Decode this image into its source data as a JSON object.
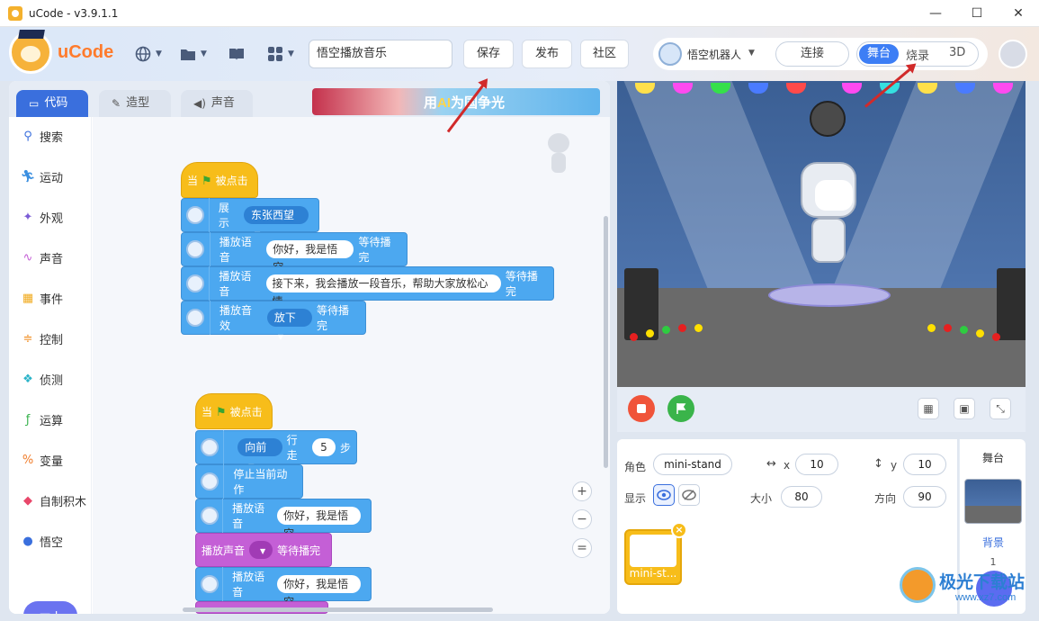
{
  "window": {
    "title": "uCode - v3.9.1.1",
    "controls": [
      "—",
      "☐",
      "✕"
    ]
  },
  "toolbar": {
    "logo": "uCode",
    "project_name": "悟空播放音乐",
    "save_label": "保存",
    "publish_label": "发布",
    "community_label": "社区",
    "robot_name": "悟空机器人",
    "connect_label": "连接",
    "mode_stage_label": "舞台",
    "mode_burn_label": "烧录",
    "mode_3d_label": "3D"
  },
  "editor": {
    "tabs": [
      {
        "label": "代码",
        "icon": "code-icon"
      },
      {
        "label": "造型",
        "icon": "brush-icon"
      },
      {
        "label": "声音",
        "icon": "speaker-icon"
      }
    ],
    "banner_text_pre": "用",
    "banner_text_ai": "AI",
    "banner_text_post": "为国争光",
    "categories": [
      {
        "label": "搜索",
        "icon": "search-icon",
        "color": "#3a6fdd"
      },
      {
        "label": "运动",
        "icon": "run-icon",
        "color": "#3a8fe0"
      },
      {
        "label": "外观",
        "icon": "sparkle-icon",
        "color": "#7b5cd6"
      },
      {
        "label": "声音",
        "icon": "sound-wave-icon",
        "color": "#c45fd6"
      },
      {
        "label": "事件",
        "icon": "calendar-icon",
        "color": "#f0a91b"
      },
      {
        "label": "控制",
        "icon": "sliders-icon",
        "color": "#f08a1b"
      },
      {
        "label": "侦测",
        "icon": "sensor-icon",
        "color": "#2ab3c8"
      },
      {
        "label": "运算",
        "icon": "fx-icon",
        "color": "#37b24d"
      },
      {
        "label": "变量",
        "icon": "variable-icon",
        "color": "#f07c2a"
      },
      {
        "label": "自制积木",
        "icon": "custom-block-icon",
        "color": "#e8476a"
      },
      {
        "label": "悟空",
        "icon": "wukong-icon",
        "color": "#3a6fdd"
      }
    ],
    "script1": {
      "hat_pre": "当",
      "hat_post": "被点击",
      "blocks": [
        {
          "label": "展示",
          "dropdown": "东张西望"
        },
        {
          "label": "播放语音",
          "input": "你好，我是悟空",
          "suffix": "等待播完"
        },
        {
          "label": "播放语音",
          "input": "接下来，我会播放一段音乐，帮助大家放松心情",
          "suffix": "等待播完"
        },
        {
          "label": "播放音效",
          "dropdown": "放下",
          "suffix": "等待播完"
        }
      ]
    },
    "script2": {
      "hat_pre": "当",
      "hat_post": "被点击",
      "blocks": [
        {
          "dropdown": "向前",
          "label": "行走",
          "number": "5",
          "suffix": "步"
        },
        {
          "label": "停止当前动作"
        },
        {
          "label": "播放语音",
          "input": "你好，我是悟空"
        },
        {
          "label": "播放声音",
          "suffix": "等待播完"
        },
        {
          "label": "播放语音",
          "input": "你好，我是悟空"
        }
      ]
    },
    "zoom": {
      "in": "+",
      "out": "−",
      "reset": "="
    }
  },
  "sprite": {
    "role_label": "角色",
    "name": "mini-stand",
    "x_label": "x",
    "x": "10",
    "y_label": "y",
    "y": "10",
    "show_label": "显示",
    "size_label": "大小",
    "size": "80",
    "direction_label": "方向",
    "direction": "90",
    "thumb_name": "mini-st..."
  },
  "stage_panel": {
    "title": "舞台",
    "backdrop_label": "背景",
    "backdrop_count": "1"
  },
  "watermark": {
    "text": "极光下载站",
    "url": "www.xz7.com"
  }
}
